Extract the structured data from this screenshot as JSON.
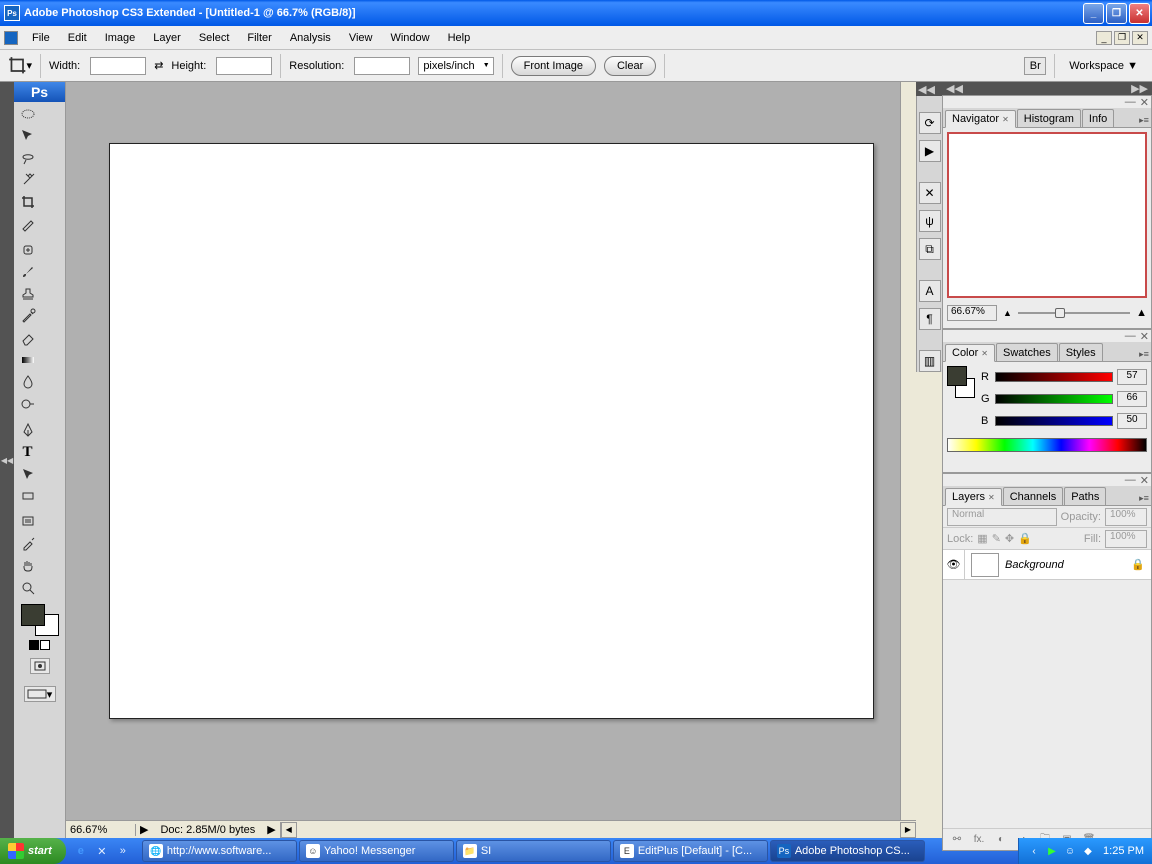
{
  "title": "Adobe Photoshop CS3 Extended - [Untitled-1 @ 66.7% (RGB/8)]",
  "menu": {
    "items": [
      "File",
      "Edit",
      "Image",
      "Layer",
      "Select",
      "Filter",
      "Analysis",
      "View",
      "Window",
      "Help"
    ]
  },
  "options": {
    "width_label": "Width:",
    "height_label": "Height:",
    "resolution_label": "Resolution:",
    "units": "pixels/inch",
    "front_image": "Front Image",
    "clear": "Clear",
    "workspace": "Workspace ▼"
  },
  "canvas": {
    "zoom": "66.67%",
    "doc_info": "Doc: 2.85M/0 bytes"
  },
  "navigator": {
    "tabs": [
      "Navigator",
      "Histogram",
      "Info"
    ],
    "zoom": "66.67%"
  },
  "color": {
    "tabs": [
      "Color",
      "Swatches",
      "Styles"
    ],
    "r_label": "R",
    "g_label": "G",
    "b_label": "B",
    "r": "57",
    "g": "66",
    "b": "50"
  },
  "layers": {
    "tabs": [
      "Layers",
      "Channels",
      "Paths"
    ],
    "blend": "Normal",
    "opacity_label": "Opacity:",
    "opacity_val": "100%",
    "lock_label": "Lock:",
    "fill_label": "Fill:",
    "fill_val": "100%",
    "bg_name": "Background"
  },
  "taskbar": {
    "start": "start",
    "tasks": [
      "http://www.software...",
      "Yahoo! Messenger",
      "SI",
      "EditPlus [Default] - [C...",
      "Adobe Photoshop CS..."
    ],
    "clock": "1:25 PM"
  }
}
